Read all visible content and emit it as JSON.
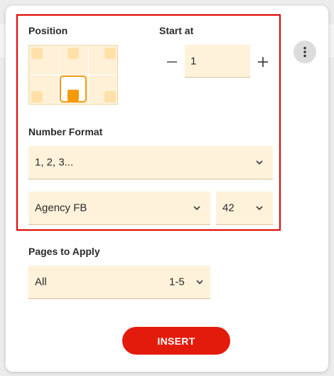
{
  "position": {
    "label": "Position"
  },
  "start_at": {
    "label": "Start at",
    "value": "1"
  },
  "number_format": {
    "label": "Number Format",
    "value": "1, 2, 3..."
  },
  "font": {
    "family": "Agency FB",
    "size": "42"
  },
  "pages": {
    "label": "Pages to Apply",
    "scope": "All",
    "range": "1-5"
  },
  "actions": {
    "insert_label": "INSERT"
  },
  "colors": {
    "accent": "#e31b0c",
    "field_bg": "#fff2da",
    "highlight": "#e00000",
    "selected": "#f59b0a"
  },
  "icons": {
    "minus": "minus-icon",
    "plus": "plus-icon",
    "chevron": "chevron-down-icon",
    "more": "more-vert-icon"
  }
}
